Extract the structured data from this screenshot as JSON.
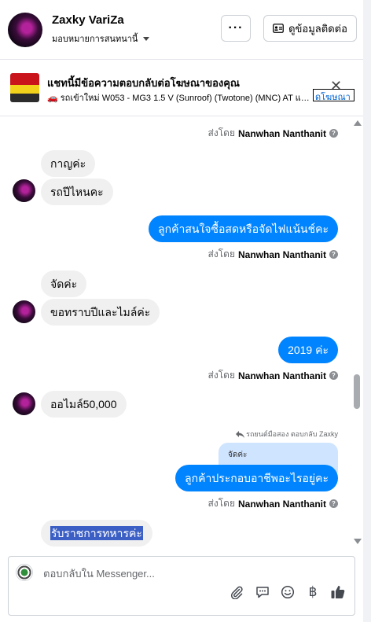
{
  "header": {
    "name": "Zaxky VariZa",
    "subtitle": "มอบหมายการสนทนานี้",
    "more_label": "···",
    "contact_label": "ดูข้อมูลติดต่อ"
  },
  "ad": {
    "title": "แชทนี้มีข้อความตอบกลับต่อโฆษณาของคุณ",
    "subtitle": "🚗 รถเข้าใหม่ W053 - MG3 1.5 V (Sunroof) (Twotone) (MNC) AT แฮ...",
    "close_label": "✕",
    "link_label": "ดูโฆษณา"
  },
  "messages": [
    {
      "id": "sent-by-1",
      "text_prefix": "ส่งโดย",
      "sender": "Nanwhan Nanthanit"
    },
    {
      "id": "in-1",
      "text": "กาญค่ะ"
    },
    {
      "id": "in-2",
      "text": "รถปีไหนคะ"
    },
    {
      "id": "out-1",
      "text": "ลูกค้าสนใจซื้อสดหรือจัดไฟแน้นช์คะ"
    },
    {
      "id": "sent-by-2",
      "text_prefix": "ส่งโดย",
      "sender": "Nanwhan Nanthanit"
    },
    {
      "id": "in-3",
      "text": "จัดค่ะ"
    },
    {
      "id": "in-4",
      "text": "ขอทราบปีและไมล์ค่ะ"
    },
    {
      "id": "out-2",
      "text": "2019 ค่ะ"
    },
    {
      "id": "sent-by-3",
      "text_prefix": "ส่งโดย",
      "sender": "Nanwhan Nanthanit"
    },
    {
      "id": "in-5",
      "text": "ออไมล์50,000"
    },
    {
      "id": "reply-note",
      "text": "รถยนต์มือสอง ตอบกลับ Zaxky"
    },
    {
      "id": "quoted",
      "text": "จัดค่ะ"
    },
    {
      "id": "out-3",
      "text": "ลูกค้าประกอบอาชีพอะไรอยู่คะ"
    },
    {
      "id": "sent-by-4",
      "text_prefix": "ส่งโดย",
      "sender": "Nanwhan Nanthanit"
    },
    {
      "id": "in-6",
      "text": "รับราชการทหารค่ะ"
    }
  ],
  "composer": {
    "placeholder": "ตอบกลับใน Messenger...",
    "tools": [
      "paperclip-icon",
      "chat-bubble-icon",
      "emoji-icon",
      "baht-icon",
      "thumbs-up-icon"
    ]
  },
  "colors": {
    "accent": "#0084ff",
    "incoming_bubble": "#f0f0f0",
    "quoted_bubble": "#cfe4ff",
    "selection": "#3b5fc4"
  }
}
